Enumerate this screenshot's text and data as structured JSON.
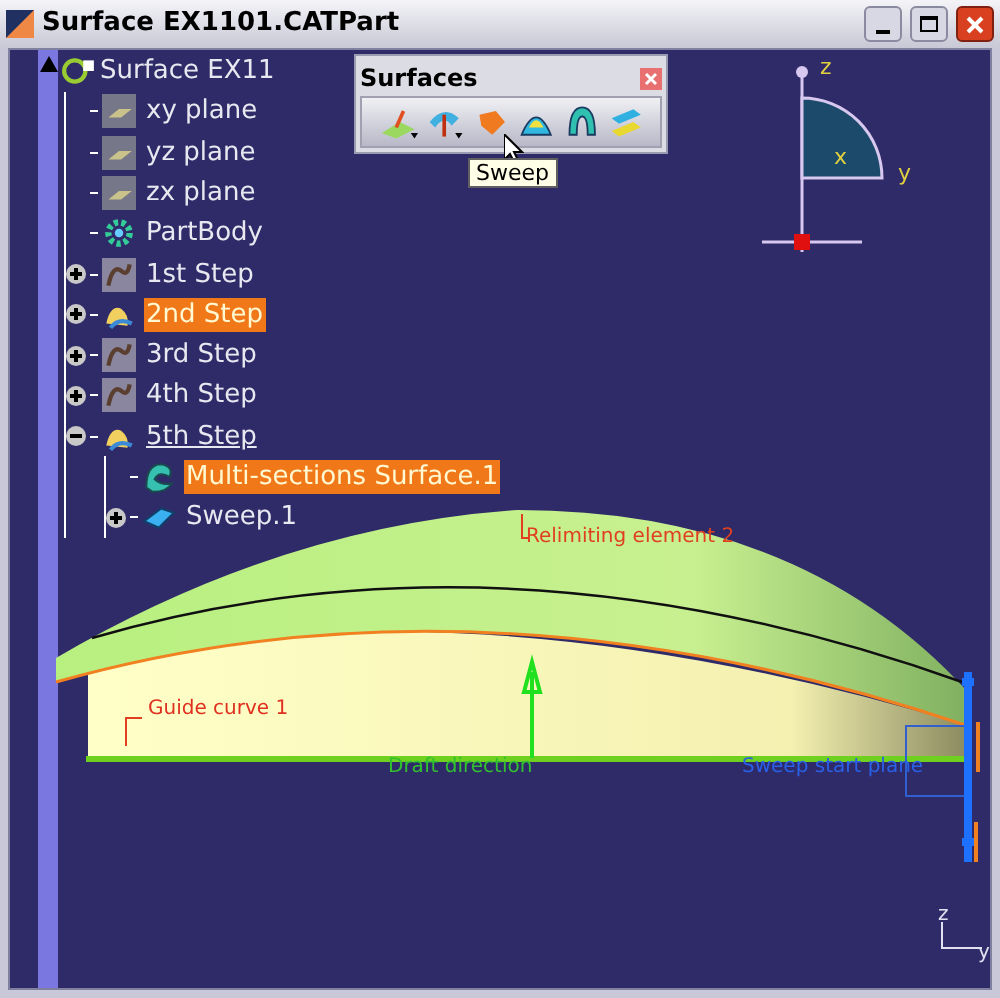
{
  "window": {
    "title": "Surface EX1101.CATPart"
  },
  "tree": {
    "label": "Surface EX11",
    "kind": "root",
    "children": [
      {
        "label": "xy plane",
        "kind": "plane",
        "selected": false,
        "current": false
      },
      {
        "label": "yz plane",
        "kind": "plane",
        "selected": false,
        "current": false
      },
      {
        "label": "zx plane",
        "kind": "plane",
        "selected": false,
        "current": false
      },
      {
        "label": "PartBody",
        "kind": "body",
        "selected": false,
        "current": false
      },
      {
        "label": "1st Step",
        "kind": "set",
        "selected": false,
        "current": false,
        "expanded": false
      },
      {
        "label": "2nd Step",
        "kind": "active-set",
        "selected": true,
        "current": false,
        "expanded": false
      },
      {
        "label": "3rd Step",
        "kind": "set",
        "selected": false,
        "current": false,
        "expanded": false
      },
      {
        "label": "4th Step",
        "kind": "set",
        "selected": false,
        "current": false,
        "expanded": false
      },
      {
        "label": "5th Step",
        "kind": "active-set",
        "selected": false,
        "current": true,
        "expanded": true,
        "children": [
          {
            "label": "Multi-sections Surface.1",
            "kind": "loft",
            "selected": true,
            "current": false
          },
          {
            "label": "Sweep.1",
            "kind": "sweep",
            "selected": false,
            "current": false,
            "expanded": false
          }
        ]
      }
    ]
  },
  "toolbar": {
    "title": "Surfaces",
    "tooltip": "Sweep"
  },
  "compass": {
    "axes": [
      "z",
      "x",
      "y"
    ]
  },
  "annotations": [
    {
      "kind": "relimiting",
      "label": "Relimiting element 2"
    },
    {
      "kind": "guide",
      "label": "Guide curve 1"
    },
    {
      "kind": "draft",
      "label": "Draft direction"
    },
    {
      "kind": "start-plane",
      "label": "Sweep start plane"
    }
  ],
  "corner_axes": [
    "z",
    "y"
  ]
}
